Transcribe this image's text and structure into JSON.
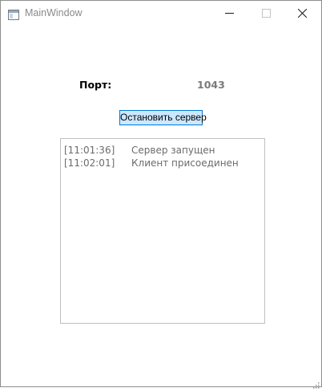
{
  "window": {
    "title": "MainWindow"
  },
  "server": {
    "port_label": "Порт:",
    "port_value": "1043",
    "stop_button_label": "Остановить сервер"
  },
  "log": {
    "entries": [
      {
        "time": "[11:01:36]",
        "message": "Сервер запущен"
      },
      {
        "time": "[11:02:01]",
        "message": "Клиент присоединен"
      }
    ]
  },
  "icons": {
    "app": "window-app-icon",
    "minimize": "minimize-icon",
    "maximize": "maximize-icon",
    "close": "close-icon",
    "grip": "resize-grip-icon"
  },
  "colors": {
    "button_bg": "#cce8ff",
    "button_border": "#0078d7",
    "log_text": "#6b6b6b",
    "port_value": "#7a7a7a"
  }
}
